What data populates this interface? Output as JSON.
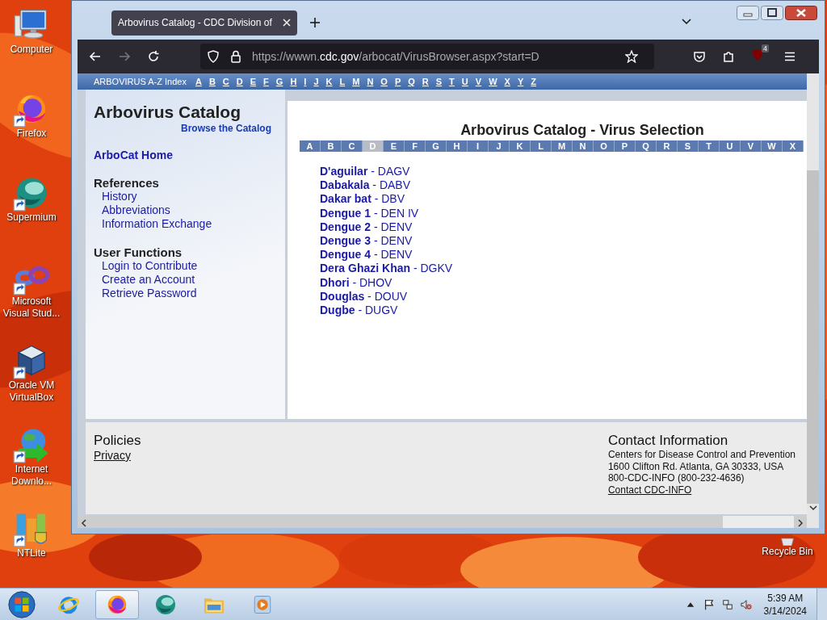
{
  "desktop": {
    "icons": [
      {
        "label": "Computer",
        "kind": "computer",
        "shortcut": false
      },
      {
        "label": "Firefox",
        "kind": "firefox",
        "shortcut": true
      },
      {
        "label": "Supermium",
        "kind": "supermium",
        "shortcut": true
      },
      {
        "label": "Microsoft Visual Stud...",
        "kind": "visual-studio",
        "shortcut": true
      },
      {
        "label": "Oracle VM VirtualBox",
        "kind": "virtualbox",
        "shortcut": true
      },
      {
        "label": "Internet Downlo...",
        "kind": "idm",
        "shortcut": true
      },
      {
        "label": "NTLite",
        "kind": "ntlite",
        "shortcut": true
      }
    ],
    "recycle_bin": {
      "label": "Recycle Bin",
      "kind": "recycle-bin"
    }
  },
  "browser": {
    "tab": {
      "title": "Arbovirus Catalog - CDC Division of",
      "selected": true
    },
    "forward_disabled": true,
    "url": {
      "prefix": "https://wwwn.",
      "domain": "cdc.gov",
      "path": "/arbocat/VirusBrowser.aspx?start=D"
    },
    "extension_badge": "4"
  },
  "page": {
    "index_label": "ARBOVIRUS A-Z Index",
    "index_letters": [
      "A",
      "B",
      "C",
      "D",
      "E",
      "F",
      "G",
      "H",
      "I",
      "J",
      "K",
      "L",
      "M",
      "N",
      "O",
      "P",
      "Q",
      "R",
      "S",
      "T",
      "U",
      "V",
      "W",
      "X",
      "Y",
      "Z"
    ],
    "sidebar": {
      "title": "Arbovirus Catalog",
      "subtitle_link": "Browse the Catalog",
      "home_link": "ArboCat Home",
      "sections": [
        {
          "heading": "References",
          "links": [
            "History",
            "Abbreviations",
            "Information Exchange"
          ]
        },
        {
          "heading": "User Functions",
          "links": [
            "Login to Contribute",
            "Create an Account",
            "Retrieve Password"
          ]
        }
      ]
    },
    "main": {
      "title": "Arbovirus Catalog - Virus Selection",
      "letters": [
        {
          "label": "A",
          "selected": false
        },
        {
          "label": "B",
          "selected": false
        },
        {
          "label": "C",
          "selected": false
        },
        {
          "label": "D",
          "selected": true
        },
        {
          "label": "E",
          "selected": false
        },
        {
          "label": "F",
          "selected": false
        },
        {
          "label": "G",
          "selected": false
        },
        {
          "label": "H",
          "selected": false
        },
        {
          "label": "I",
          "selected": false
        },
        {
          "label": "J",
          "selected": false
        },
        {
          "label": "K",
          "selected": false
        },
        {
          "label": "L",
          "selected": false
        },
        {
          "label": "M",
          "selected": false
        },
        {
          "label": "N",
          "selected": false
        },
        {
          "label": "O",
          "selected": false
        },
        {
          "label": "P",
          "selected": false
        },
        {
          "label": "Q",
          "selected": false
        },
        {
          "label": "R",
          "selected": false
        },
        {
          "label": "S",
          "selected": false
        },
        {
          "label": "T",
          "selected": false
        },
        {
          "label": "U",
          "selected": false
        },
        {
          "label": "V",
          "selected": false
        },
        {
          "label": "W",
          "selected": false
        },
        {
          "label": "X",
          "selected": false
        }
      ],
      "viruses": [
        "**D'aguilar** - DAGV",
        "**Dabakala** - DABV",
        "**Dakar bat** - DBV",
        "**Dengue 1** - DEN IV",
        "**Dengue 2** - DENV",
        "**Dengue 3** - DENV",
        "**Dengue 4** - DENV",
        "**Dera Ghazi Khan** - DGKV",
        "**Dhori** - DHOV",
        "**Douglas** - DOUV",
        "**Dugbe** - DUGV"
      ]
    },
    "footer": {
      "policies_heading": "Policies",
      "privacy_link": "Privacy",
      "contact_heading": "Contact Information",
      "contact_lines": [
        "Centers for Disease Control and Prevention",
        "1600 Clifton Rd. Atlanta, GA 30333, USA",
        "800-CDC-INFO (800-232-4636)"
      ],
      "contact_link": "Contact CDC-INFO"
    }
  },
  "taskbar": {
    "items": [
      {
        "kind": "ie",
        "selected": false
      },
      {
        "kind": "firefox",
        "selected": true
      },
      {
        "kind": "supermium",
        "selected": false
      },
      {
        "kind": "explorer",
        "selected": false
      },
      {
        "kind": "media",
        "selected": false
      }
    ],
    "time": "5:39 AM",
    "date": "3/14/2024"
  }
}
